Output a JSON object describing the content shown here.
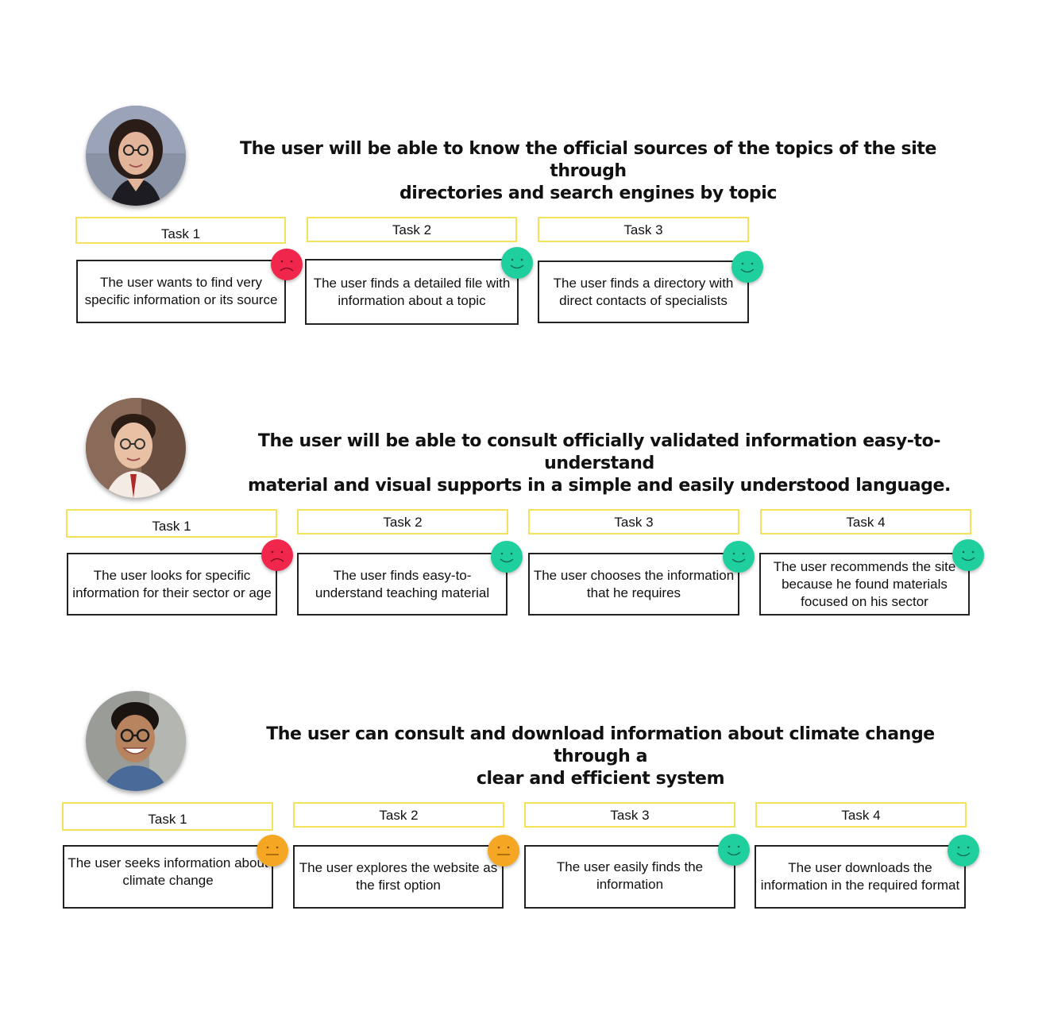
{
  "colors": {
    "label_border": "#f2e35a",
    "happy": "#1fcf9e",
    "sad": "#f0264d",
    "neutral": "#f5a623"
  },
  "rows": [
    {
      "title_line1": "The user will be able to know the official sources of the topics of the site through",
      "title_line2": "directories and search engines by topic",
      "tasks": [
        {
          "label": "Task 1",
          "text": "The user wants to find very specific information or its source",
          "mood": "sad-face-icon"
        },
        {
          "label": "Task 2",
          "text": "The user finds a detailed file with information about a topic",
          "mood": "happy-face-icon"
        },
        {
          "label": "Task 3",
          "text": "The user finds a directory with direct contacts of specialists",
          "mood": "happy-face-icon"
        }
      ]
    },
    {
      "title_line1": "The user will be able to consult officially validated information  easy-to-understand",
      "title_line2": "material and visual supports in a simple and easily understood language.",
      "tasks": [
        {
          "label": "Task 1",
          "text": "The user looks for specific information for their sector or age",
          "mood": "sad-face-icon"
        },
        {
          "label": "Task 2",
          "text": "The user finds easy-to-understand teaching material",
          "mood": "happy-face-icon"
        },
        {
          "label": "Task 3",
          "text": "The user chooses the information that he requires",
          "mood": "happy-face-icon"
        },
        {
          "label": "Task 4",
          "text": "The user recommends the site because he found materials focused on his sector",
          "mood": "happy-face-icon"
        }
      ]
    },
    {
      "title_line1": "The user can consult and download information about climate change through a",
      "title_line2": "clear and efficient system",
      "tasks": [
        {
          "label": "Task 1",
          "text": "The user seeks information about climate change",
          "mood": "neutral-face-icon"
        },
        {
          "label": "Task 2",
          "text": "The user explores the website as the first option",
          "mood": "neutral-face-icon"
        },
        {
          "label": "Task 3",
          "text": "The user easily finds the information",
          "mood": "happy-face-icon"
        },
        {
          "label": "Task 4",
          "text": "The user downloads the information in the required format",
          "mood": "happy-face-icon"
        }
      ]
    }
  ]
}
